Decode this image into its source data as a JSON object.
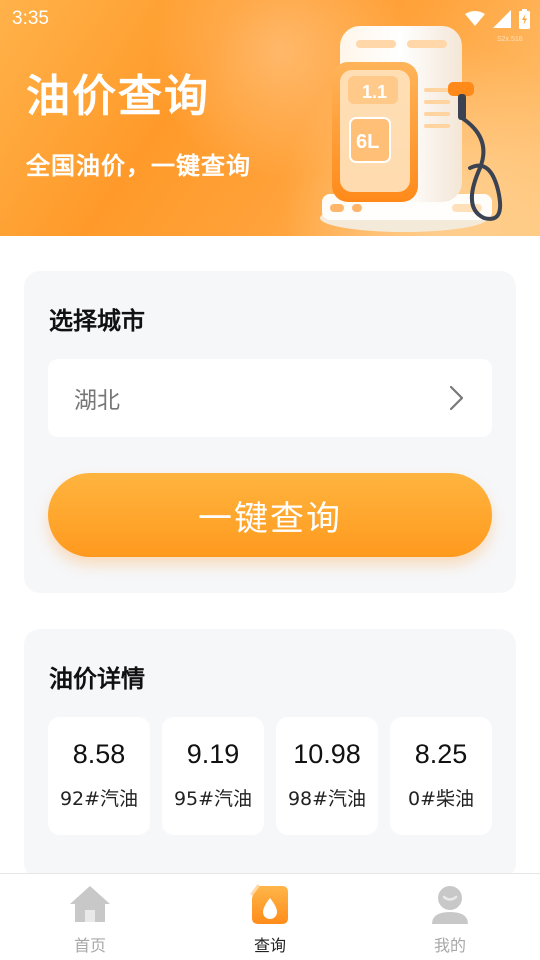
{
  "status_bar": {
    "time": "3:35",
    "icons": [
      "wifi-icon",
      "signal-icon",
      "battery-charging-icon"
    ]
  },
  "header": {
    "title": "油价查询",
    "subtitle": "全国油价，一键查询",
    "illustration": "fuel-pump-illustration",
    "pump_display": "6L",
    "colors": {
      "gradient_start": "#ffb24a",
      "gradient_mid": "#ff9a2a",
      "gradient_end": "#ffc67a"
    }
  },
  "city_card": {
    "heading": "选择城市",
    "selected_city": "湖北",
    "query_button_label": "一键查询"
  },
  "price_card": {
    "heading": "油价详情",
    "prices": [
      {
        "value": "8.58",
        "label": "92#汽油"
      },
      {
        "value": "9.19",
        "label": "95#汽油"
      },
      {
        "value": "10.98",
        "label": "98#汽油"
      },
      {
        "value": "8.25",
        "label": "0#柴油"
      }
    ]
  },
  "bottom_nav": {
    "items": [
      {
        "label": "首页",
        "icon": "home-icon",
        "active": false
      },
      {
        "label": "查询",
        "icon": "query-oil-icon",
        "active": true
      },
      {
        "label": "我的",
        "icon": "profile-icon",
        "active": false
      }
    ]
  },
  "colors": {
    "accent": "#ff9a1e",
    "card_bg": "#f6f7f9",
    "nav_inactive": "#a8a8a8"
  }
}
